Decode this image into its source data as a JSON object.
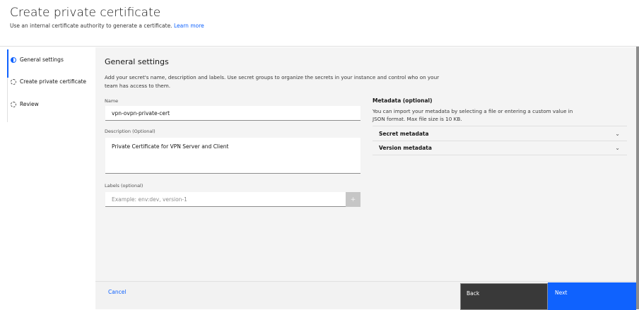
{
  "header": {
    "title": "Create private certificate",
    "subtitle": "Use an internal certificate authority to generate a certificate.",
    "learn_more": "Learn more"
  },
  "steps": [
    {
      "label": "General settings",
      "state": "current"
    },
    {
      "label": "Create private certificate",
      "state": "incomplete"
    },
    {
      "label": "Review",
      "state": "incomplete"
    }
  ],
  "main": {
    "heading": "General settings",
    "description": "Add your secret's name, description and labels. Use secret groups to organize the secrets in your instance and control who on your team has access to them.",
    "name_label": "Name",
    "name_value": "vpn-ovpn-private-cert",
    "description_label": "Description (Optional)",
    "description_value": "Private Certificate for VPN Server and Client",
    "labels_label": "Labels (optional)",
    "labels_placeholder": "Example: env:dev, version-1",
    "labels_add": "+",
    "metadata_title": "Metadata (optional)",
    "metadata_desc": "You can import your metadata by selecting a file or entering a custom value in JSON format. Max file size is 10 KB.",
    "accordions": [
      {
        "label": "Secret metadata"
      },
      {
        "label": "Version metadata"
      }
    ]
  },
  "footer": {
    "cancel": "Cancel",
    "back": "Back",
    "next": "Next"
  },
  "colors": {
    "accent": "#0f62fe",
    "back_bg": "#393939"
  }
}
